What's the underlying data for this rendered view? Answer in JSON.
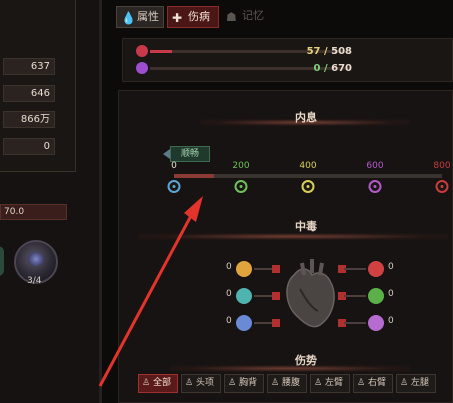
{
  "left_panel": {
    "stats": [
      "637",
      "646",
      "866万",
      "0"
    ],
    "bar_value": "70.0",
    "orb_count": "3/4"
  },
  "tabs": {
    "attributes": "属性",
    "injury": "伤病",
    "memory": "记忆"
  },
  "vitals": {
    "health": {
      "current": "57",
      "max": "508",
      "fraction": 0.112,
      "color": "#c8394a"
    },
    "inner": {
      "current": "0",
      "max": "670",
      "fraction": 0.0,
      "color": "#9b4fd0"
    }
  },
  "qi_section": {
    "title": "内息",
    "status_tag": "顺畅",
    "ticks": [
      "0",
      "200",
      "400",
      "600",
      "800"
    ],
    "tick_colors": [
      "#5aa6d6",
      "#6fbf5c",
      "#d8cf58",
      "#b45acb",
      "#c83c3c"
    ],
    "current_value": 120
  },
  "poison_section": {
    "title": "中毒",
    "left_values": [
      "0",
      "0",
      "0"
    ],
    "right_values": [
      "0",
      "0",
      "0"
    ]
  },
  "injury_section": {
    "title": "伤势",
    "body_tabs": [
      "全部",
      "头项",
      "胸背",
      "腰腹",
      "左臂",
      "右臂",
      "左腿"
    ]
  }
}
